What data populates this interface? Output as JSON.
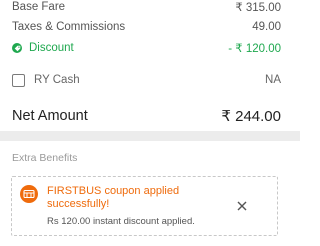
{
  "fare": {
    "base_fare_label": "Base Fare",
    "base_fare_value": "₹ 315.00",
    "taxes_label": "Taxes & Commissions",
    "taxes_value": "49.00",
    "discount_label": "Discount",
    "discount_value": "- ₹ 120.00"
  },
  "ry_cash": {
    "label": "RY Cash",
    "value": "NA",
    "checked": false
  },
  "net": {
    "label": "Net Amount",
    "value": "₹ 244.00"
  },
  "extra_benefits": {
    "title": "Extra Benefits",
    "coupon_title": "FIRSTBUS coupon applied successfully!",
    "coupon_subtitle": "Rs 120.00 instant discount applied."
  },
  "colors": {
    "discount_green": "#1fa84f",
    "coupon_orange": "#ef6b0c"
  },
  "icons": {
    "discount": "discount-icon",
    "coupon": "coupon-icon",
    "close": "close-icon"
  }
}
